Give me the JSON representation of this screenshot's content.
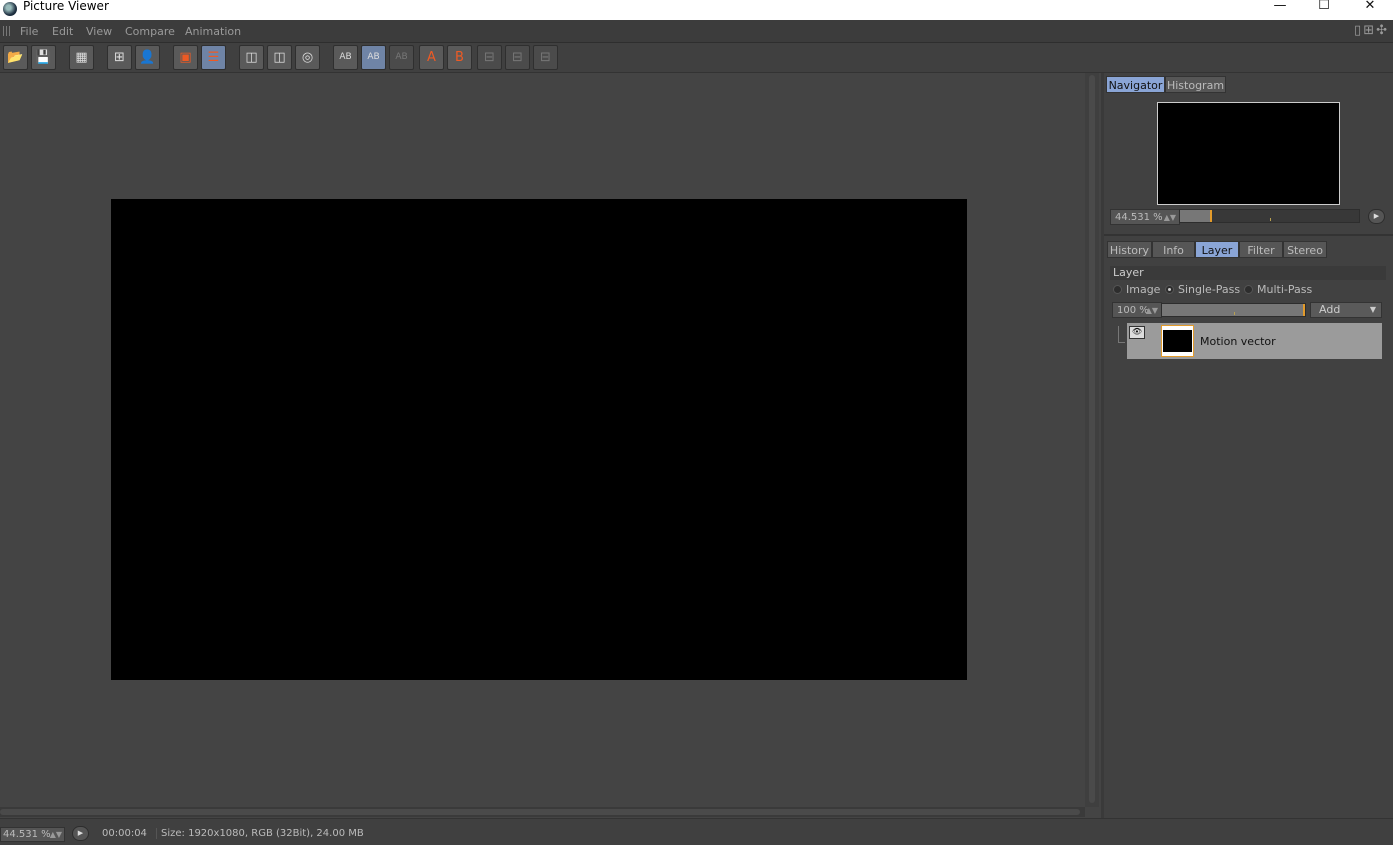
{
  "window": {
    "title": "Picture Viewer",
    "minimize_glyph": "—",
    "maximize_glyph": "☐",
    "close_glyph": "✕"
  },
  "menu": [
    "File",
    "Edit",
    "View",
    "Compare",
    "Animation"
  ],
  "menu_layout_icons": "▯⊞✣",
  "toolbar": [
    {
      "name": "open-icon",
      "glyph": "📂",
      "state": "normal"
    },
    {
      "name": "save-icon",
      "glyph": "💾",
      "state": "normal"
    },
    {
      "name": "region-render-icon",
      "glyph": "▦",
      "state": "normal"
    },
    {
      "name": "render-grid-icon",
      "glyph": "⊞",
      "state": "normal"
    },
    {
      "name": "render-person-icon",
      "glyph": "👤",
      "state": "normal"
    },
    {
      "name": "stop-render-icon",
      "glyph": "▣",
      "state": "normal"
    },
    {
      "name": "render-queue-icon",
      "glyph": "☰",
      "state": "active"
    },
    {
      "name": "view-frame-1-icon",
      "glyph": "◫",
      "state": "normal"
    },
    {
      "name": "view-frame-2-icon",
      "glyph": "◫",
      "state": "normal"
    },
    {
      "name": "view-frame-3-icon",
      "glyph": "◎",
      "state": "normal"
    },
    {
      "name": "ab-compare-icon",
      "glyph": "AB",
      "state": "normal"
    },
    {
      "name": "ab-split-icon",
      "glyph": "AB",
      "state": "active"
    },
    {
      "name": "ab-swap-icon",
      "glyph": "AB",
      "state": "disabled"
    },
    {
      "name": "set-a-icon",
      "glyph": "A",
      "state": "normal"
    },
    {
      "name": "set-b-icon",
      "glyph": "B",
      "state": "normal"
    },
    {
      "name": "compare-mode-1-icon",
      "glyph": "⊟",
      "state": "disabled"
    },
    {
      "name": "compare-mode-2-icon",
      "glyph": "⊟",
      "state": "disabled"
    },
    {
      "name": "compare-mode-3-icon",
      "glyph": "⊟",
      "state": "disabled"
    }
  ],
  "navigator": {
    "tabs": [
      {
        "label": "Navigator",
        "active": true
      },
      {
        "label": "Histogram",
        "active": false
      }
    ],
    "zoom": "44.531 %",
    "zoom_level": 0.17
  },
  "info_tabs": [
    {
      "label": "History",
      "active": false
    },
    {
      "label": "Info",
      "active": false
    },
    {
      "label": "Layer",
      "active": true
    },
    {
      "label": "Filter",
      "active": false
    },
    {
      "label": "Stereo",
      "active": false
    }
  ],
  "layer_panel": {
    "header": "Layer",
    "modes": [
      {
        "label": "Image",
        "selected": false
      },
      {
        "label": "Single-Pass",
        "selected": true
      },
      {
        "label": "Multi-Pass",
        "selected": false
      }
    ],
    "opacity": "100 %",
    "opacity_level": 1.0,
    "add_label": "Add",
    "layers": [
      {
        "name": "Motion vector",
        "visible": true
      }
    ]
  },
  "status": {
    "zoom": "44.531 %",
    "time": "00:00:04",
    "size": "Size: 1920x1080, RGB (32Bit), 24.00 MB"
  },
  "colors": {
    "accent": "#8aa5d6",
    "toolbar_orange": "#ee5a24",
    "slider_knob": "#e39b2b"
  }
}
